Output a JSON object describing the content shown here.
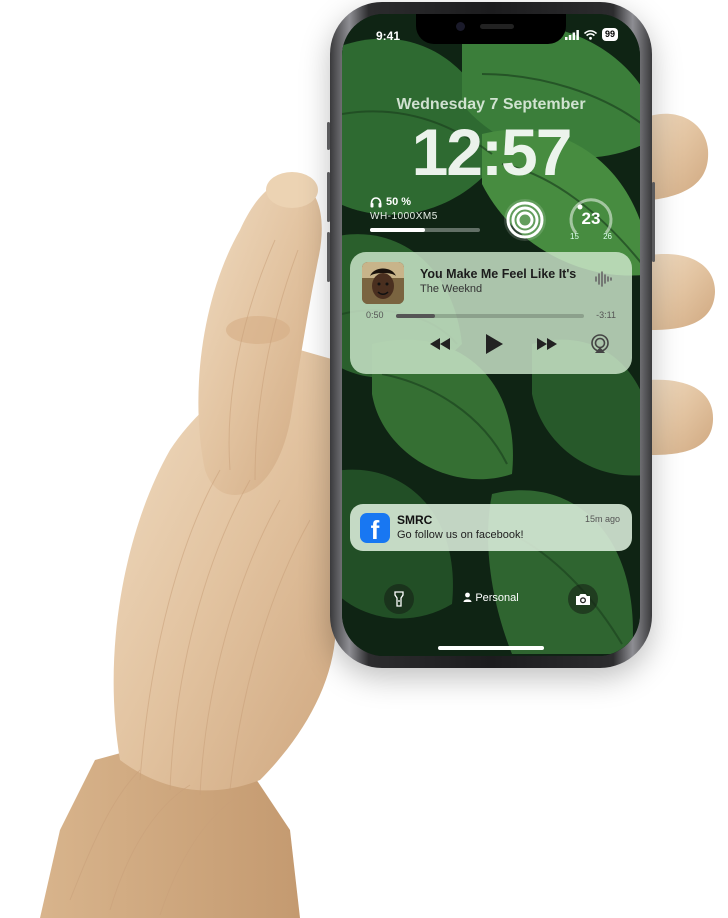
{
  "status_bar": {
    "time": "9:41",
    "battery": "99"
  },
  "lock_screen": {
    "date": "Wednesday 7 September",
    "time": "12:57"
  },
  "widgets": {
    "headphones": {
      "percent": "50 %",
      "device": "WH-1000XM5",
      "level": 0.5
    },
    "weather": {
      "temperature": "23",
      "low": "15",
      "high": "26"
    }
  },
  "now_playing": {
    "title": "You Make Me Feel Like It's",
    "artist": "The Weeknd",
    "elapsed": "0:50",
    "remaining": "-3:11",
    "progress": 0.21
  },
  "notification": {
    "app": "SMRC",
    "time": "15m ago",
    "message": "Go follow us on facebook!",
    "icon": "facebook-icon"
  },
  "bottom": {
    "focus_label": "Personal"
  },
  "colors": {
    "facebook": "#1877f2",
    "wood": "#e3c6a4",
    "leaf": "#2f6b34"
  }
}
